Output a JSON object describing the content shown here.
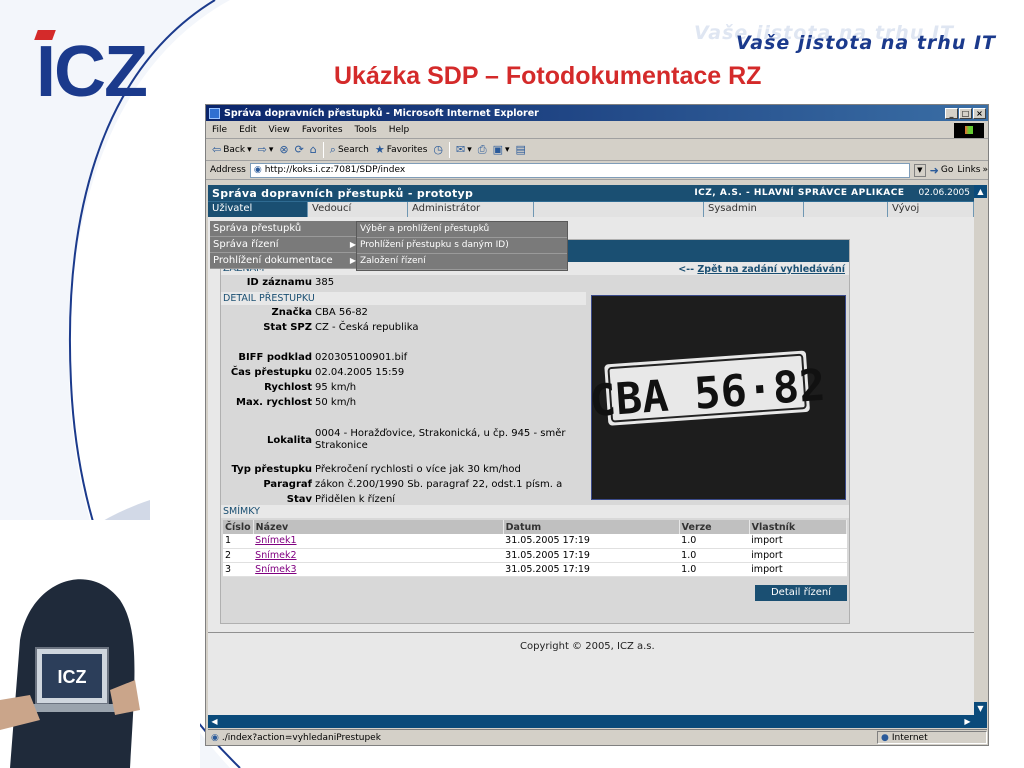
{
  "slide": {
    "logo_text": "ICZ",
    "tagline": "Vaše jistota na trhu IT",
    "title": "Ukázka SDP – Fotodokumentace RZ",
    "laptop_logo": "ICZ"
  },
  "browser": {
    "window_title": "Správa dopravních přestupků - Microsoft Internet Explorer",
    "menu": [
      "File",
      "Edit",
      "View",
      "Favorites",
      "Tools",
      "Help"
    ],
    "toolbar": {
      "back": "Back",
      "search": "Search",
      "favorites": "Favorites"
    },
    "address_label": "Address",
    "url": "http://koks.i.cz:7081/SDP/index",
    "go": "Go",
    "links": "Links",
    "status_text": "./index?action=vyhledaniPrestupek",
    "status_zone": "Internet"
  },
  "app": {
    "title": "Správa dopravních přestupků - prototyp",
    "admin": "ICZ, A.S. - HLAVNÍ SPRÁVCE APLIKACE",
    "date": "02.06.2005",
    "nav": [
      "Uživatel",
      "Vedoucí",
      "Administrátor",
      "",
      "Sysadmin",
      "",
      "Vývoj"
    ],
    "menu_l1": [
      "Správa přestupků",
      "Správa řízení",
      "Prohlížení dokumentace"
    ],
    "menu_l2": [
      "Výběr a prohlížení přestupků",
      "Prohlížení přestupku s daným ID)",
      "Založení řízení"
    ],
    "section_record": "ZÁZNAM",
    "back_link_prefix": "<-- ",
    "back_link": "Zpět na zadání vyhledávání",
    "fields": {
      "id_label": "ID záznamu",
      "id_value": "385",
      "section_detail": "DETAIL PŘESTUPKU",
      "plate_label": "Značka",
      "plate_value": "CBA 56-82",
      "state_label": "Stat SPZ",
      "state_value": "CZ - Česká republika",
      "biff_label": "BIFF podklad",
      "biff_value": "020305100901.bif",
      "time_label": "Čas přestupku",
      "time_value": "02.04.2005 15:59",
      "speed_label": "Rychlost",
      "speed_value": "95 km/h",
      "max_label": "Max. rychlost",
      "max_value": "50 km/h",
      "loc_label": "Lokalita",
      "loc_value": "0004 - Horažďovice, Strakonická, u čp. 945 - směr Strakonice",
      "type_label": "Typ přestupku",
      "type_value": "Překročení rychlosti o více jak 30 km/hod",
      "par_label": "Paragraf",
      "par_value": "zákon č.200/1990 Sb. paragraf 22, odst.1 písm. a",
      "state2_label": "Stav",
      "state2_value": "Přidělen k řízení"
    },
    "photo_plate_text": "CBA 56·82",
    "section_images": "SMÍMKY",
    "table": {
      "headers": [
        "Číslo",
        "Název",
        "Datum",
        "Verze",
        "Vlastník"
      ],
      "rows": [
        [
          "1",
          "Snímek1",
          "31.05.2005 17:19",
          "1.0",
          "import"
        ],
        [
          "2",
          "Snímek2",
          "31.05.2005 17:19",
          "1.0",
          "import"
        ],
        [
          "3",
          "Snímek3",
          "31.05.2005 17:19",
          "1.0",
          "import"
        ]
      ]
    },
    "detail_button": "Detail řízení",
    "copyright": "Copyright © 2005, ICZ a.s."
  }
}
